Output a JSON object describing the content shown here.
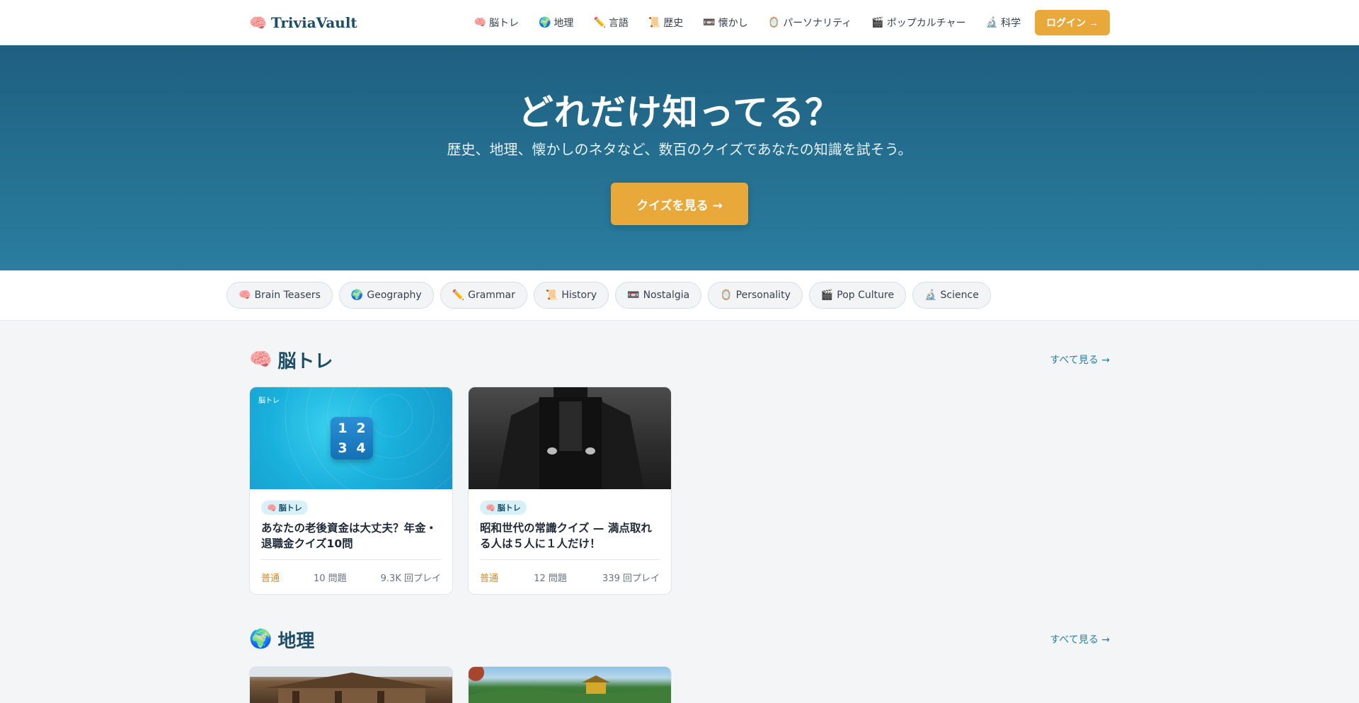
{
  "header": {
    "logo_icon": "brain-icon",
    "logo_emoji": "🧠",
    "logo_text": "TriviaVault",
    "nav": [
      {
        "emoji": "🧠",
        "icon": "brain-icon",
        "label": "脳トレ"
      },
      {
        "emoji": "🌍",
        "icon": "globe-icon",
        "label": "地理"
      },
      {
        "emoji": "✏️",
        "icon": "pencil-icon",
        "label": "言語"
      },
      {
        "emoji": "📜",
        "icon": "scroll-icon",
        "label": "歴史"
      },
      {
        "emoji": "📼",
        "icon": "cassette-icon",
        "label": "懐かし"
      },
      {
        "emoji": "🪞",
        "icon": "mirror-icon",
        "label": "パーソナリティ"
      },
      {
        "emoji": "🎬",
        "icon": "clapper-icon",
        "label": "ポップカルチャー"
      },
      {
        "emoji": "🔬",
        "icon": "microscope-icon",
        "label": "科学"
      }
    ],
    "login_label": "ログイン →"
  },
  "hero": {
    "title": "どれだけ知ってる？",
    "subtitle": "歴史、地理、懐かしのネタなど、数百のクイズであなたの知識を試そう。",
    "cta_label": "クイズを見る →"
  },
  "pills": [
    {
      "emoji": "🧠",
      "icon": "brain-icon",
      "label": "Brain Teasers"
    },
    {
      "emoji": "🌍",
      "icon": "globe-icon",
      "label": "Geography"
    },
    {
      "emoji": "✏️",
      "icon": "pencil-icon",
      "label": "Grammar"
    },
    {
      "emoji": "📜",
      "icon": "scroll-icon",
      "label": "History"
    },
    {
      "emoji": "📼",
      "icon": "cassette-icon",
      "label": "Nostalgia"
    },
    {
      "emoji": "🪞",
      "icon": "mirror-icon",
      "label": "Personality"
    },
    {
      "emoji": "🎬",
      "icon": "clapper-icon",
      "label": "Pop Culture"
    },
    {
      "emoji": "🔬",
      "icon": "microscope-icon",
      "label": "Science"
    }
  ],
  "sections": [
    {
      "emoji": "🧠",
      "icon": "brain-icon",
      "title": "脳トレ",
      "see_all": "すべて見る →",
      "cards": [
        {
          "image_label": "脳トレ",
          "tile_digits": [
            "1",
            "2",
            "3",
            "4"
          ],
          "badge_emoji": "🧠",
          "badge": "脳トレ",
          "title": "あなたの老後資金は大丈夫？年金・退職金クイズ10問",
          "difficulty": "普通",
          "questions": "10 問題",
          "plays": "9.3K 回プレイ"
        },
        {
          "badge_emoji": "🧠",
          "badge": "脳トレ",
          "title": "昭和世代の常識クイズ — 満点取れる人は５人に１人だけ！",
          "difficulty": "普通",
          "questions": "12 問題",
          "plays": "339 回プレイ"
        }
      ]
    },
    {
      "emoji": "🌍",
      "icon": "globe-icon",
      "title": "地理",
      "see_all": "すべて見る →"
    }
  ],
  "colors": {
    "accent": "#e8a83a",
    "brand": "#1d4e68",
    "hero_top": "#1f5f80",
    "hero_bottom": "#2a7ea0",
    "link": "#2a7ea0",
    "difficulty": "#d98a1a"
  }
}
